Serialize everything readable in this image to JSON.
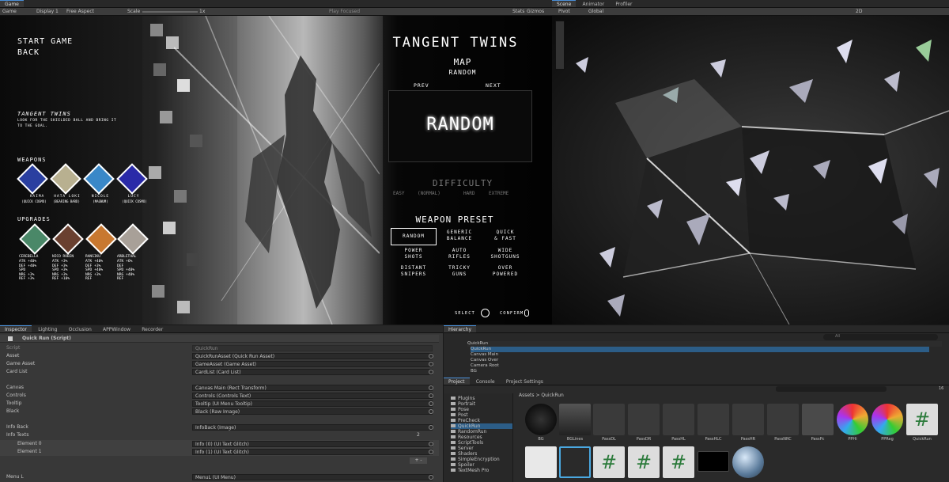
{
  "game_panel": {
    "tab": "Game",
    "toolbar": {
      "view": "Game",
      "display": "Display 1",
      "aspect": "Free Aspect",
      "scale_label": "Scale",
      "scale_value": "1x",
      "play_focused": "Play Focused",
      "stats": "Stats",
      "gizmos": "Gizmos"
    }
  },
  "scene_panel": {
    "tabs": [
      "Scene",
      "Animator",
      "Profiler"
    ],
    "toolbar": {
      "pivot": "Pivot",
      "global": "Global",
      "mode_2d": "2D"
    }
  },
  "game_ui": {
    "menu": [
      "START GAME",
      "BACK"
    ],
    "mode_title": "TANGENT TWINS",
    "mode_desc_1": "LOOK FOR THE SHIELDED BALL AND BRING IT",
    "mode_desc_2": "TO THE GOAL.",
    "weapons_label": "WEAPONS",
    "weapons": [
      {
        "name": "HAIMA",
        "sub": "(QUICK COSMO)",
        "color": "#2a3fa0"
      },
      {
        "name": "HATA LOKI",
        "sub": "(BEARING BARD)",
        "color": "#b8b090"
      },
      {
        "name": "NICOLE",
        "sub": "(MAGNUM)",
        "color": "#3a88c8"
      },
      {
        "name": "LUCY",
        "sub": "(QUICK COSMO)",
        "color": "#2a2aa8"
      }
    ],
    "upgrades_label": "UPGRADES",
    "upgrades": [
      {
        "name": "CEREBELLA",
        "stats": "ATK +40%\nDEF +40%\nSPD\nNRG +3%\nREF +3%",
        "color": "#4a8868",
        "num": "1"
      },
      {
        "name": "NICO ROBIN",
        "stats": "ATK +3%\nDEF +3%\nSPD +3%\nNRG +3%\nREF +10%",
        "color": "#6a4030",
        "num": ""
      },
      {
        "name": "RANSIKU",
        "stats": "ATK +40%\nDEF +3%\nSPD +40%\nNRG +3%\nREF",
        "color": "#c87830",
        "num": "1"
      },
      {
        "name": "ARBLETHAL",
        "stats": "ATK +6%\nDEF\nSPD +40%\nNRG +40%\nREF",
        "color": "#a8a098",
        "num": "1"
      }
    ],
    "title": "TANGENT TWINS",
    "map_label": "MAP",
    "map_value": "RANDOM",
    "prev": "PREV",
    "next": "NEXT",
    "map_big": "RANDOM",
    "difficulty_label": "DIFFICULTY",
    "difficulties": [
      "EASY",
      "(NORMAL)",
      "HARD",
      "EXTREME"
    ],
    "preset_label": "WEAPON PRESET",
    "presets": [
      "RANDOM",
      "GENERIC\nBALANCE",
      "QUICK\n& FAST",
      "POWER\nSHOTS",
      "AUTO\nRIFLES",
      "WIDE\nSHOTGUNS",
      "DISTANT\nSNIPERS",
      "TRICKY\nGUNS",
      "OVER\nPOWERED"
    ],
    "select": "SELECT",
    "confirm": "CONFIRM"
  },
  "inspector": {
    "tabs": [
      "Inspector",
      "Lighting",
      "Occlusion",
      "APPWindow",
      "Recorder"
    ],
    "component": "Quick Run (Script)",
    "rows": [
      {
        "label": "Script",
        "value": "QuickRun"
      },
      {
        "label": "Asset",
        "value": "QuickRunAsset (Quick Run Asset)"
      },
      {
        "label": "Game Asset",
        "value": "GameAsset (Game Asset)"
      },
      {
        "label": "Card List",
        "value": "CardList (Card List)"
      },
      {
        "label": "Canvas",
        "value": "Canvas Main (Rect Transform)"
      },
      {
        "label": "Controls",
        "value": "Controls (Controls Text)"
      },
      {
        "label": "Tooltip",
        "value": "Tooltip (UI Menu Tooltip)"
      },
      {
        "label": "Black",
        "value": "Black (Raw Image)"
      },
      {
        "label": "Info Back",
        "value": "InfoBack (Image)"
      },
      {
        "label": "Element 0",
        "value": "Info (0) (UI Text Glitch)"
      },
      {
        "label": "Element 1",
        "value": "Info (1) (UI Text Glitch)"
      },
      {
        "label": "Menu L",
        "value": "MenuL (UI Menu)"
      }
    ],
    "info_texts": "Info Texts",
    "info_count": "2"
  },
  "hierarchy": {
    "tab": "Hierarchy",
    "search_placeholder": "All",
    "items": [
      "QuickRun",
      "QuickRun",
      "Canvas Main",
      "Canvas Over",
      "Camera Root",
      "BG"
    ]
  },
  "project": {
    "tabs": [
      "Project",
      "Console",
      "Project Settings"
    ],
    "breadcrumb_root": "Assets",
    "breadcrumb_leaf": "QuickRun",
    "folders": [
      "Plugins",
      "Portrait",
      "Pose",
      "Post",
      "PreCheck",
      "QuickRun",
      "RandomRun",
      "Resources",
      "ScriptTools",
      "Server",
      "Shaders",
      "SimpleEncryption",
      "Spoiler",
      "TextMesh Pro"
    ],
    "assets_row1": [
      "BG",
      "BGLines",
      "PassDL",
      "PassDR",
      "PassHL",
      "PassHLC",
      "PassHR",
      "PassNRC",
      "PassPc",
      "PPHi",
      "PPReg",
      "QuickRun"
    ],
    "count": "16"
  }
}
